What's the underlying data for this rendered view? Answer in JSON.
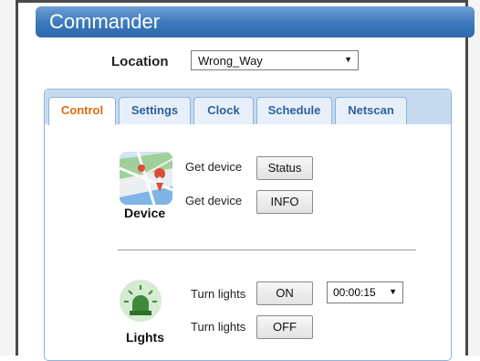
{
  "app": {
    "title": "Commander"
  },
  "location": {
    "label": "Location",
    "selected": "Wrong_Way"
  },
  "tabs": [
    {
      "label": "Control",
      "active": true
    },
    {
      "label": "Settings",
      "active": false
    },
    {
      "label": "Clock",
      "active": false
    },
    {
      "label": "Schedule",
      "active": false
    },
    {
      "label": "Netscan",
      "active": false
    }
  ],
  "device": {
    "caption": "Device",
    "rows": [
      {
        "label": "Get device",
        "button": "Status"
      },
      {
        "label": "Get device",
        "button": "INFO"
      }
    ]
  },
  "lights": {
    "caption": "Lights",
    "rows": [
      {
        "label": "Turn lights",
        "button": "ON"
      },
      {
        "label": "Turn lights",
        "button": "OFF"
      }
    ],
    "timer": "00:00:15"
  },
  "colors": {
    "header": "#3b78bc",
    "active_tab_text": "#e06a10",
    "tab_text": "#2f5f99",
    "tab_border": "#8fb4dc"
  }
}
